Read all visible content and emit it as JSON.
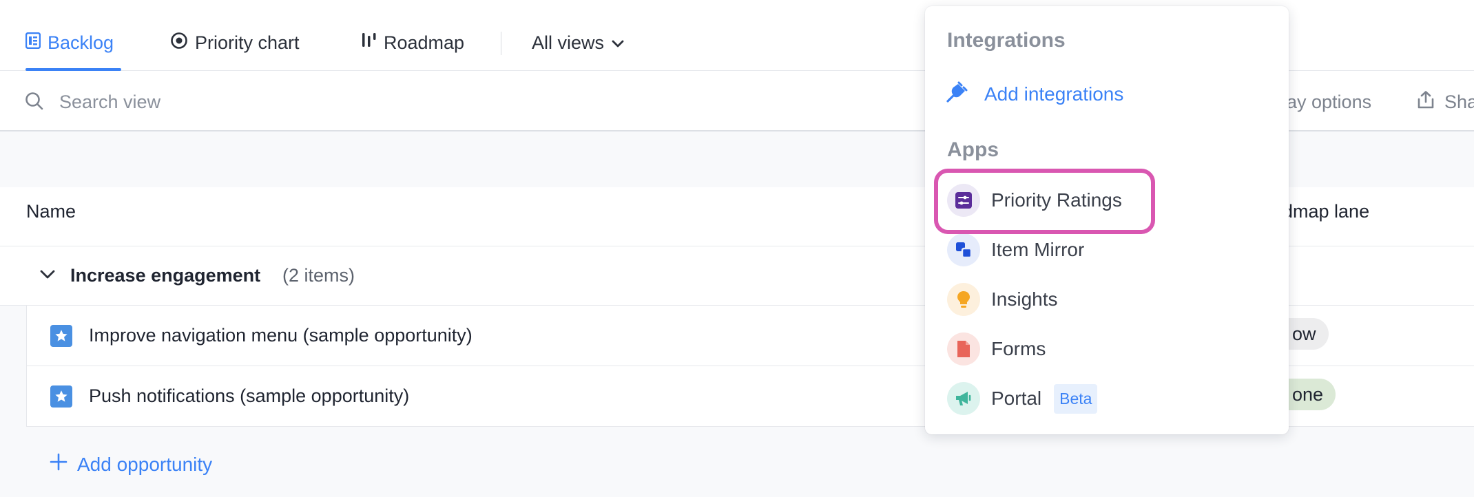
{
  "tabs": [
    {
      "label": "Backlog",
      "icon": "list-doc-icon",
      "active": true
    },
    {
      "label": "Priority chart",
      "icon": "target-icon",
      "active": false
    },
    {
      "label": "Roadmap",
      "icon": "roadmap-icon",
      "active": false
    }
  ],
  "all_views": {
    "label": "All views",
    "icon": "chevron-down-icon"
  },
  "search": {
    "placeholder": "Search view"
  },
  "toolbar": {
    "display_options": "lay options",
    "share": "Sha"
  },
  "table": {
    "columns": {
      "name": "Name",
      "roadmap_lane": "dmap lane"
    },
    "group": {
      "label": "Increase engagement",
      "count": "(2 items)"
    },
    "rows": [
      {
        "label": "Improve navigation menu (sample opportunity)",
        "lane": "ow"
      },
      {
        "label": "Push notifications (sample opportunity)",
        "lane": "one"
      }
    ],
    "add_label": "Add opportunity"
  },
  "dropdown": {
    "integrations_heading": "Integrations",
    "add_integrations": "Add integrations",
    "apps_heading": "Apps",
    "apps": [
      {
        "label": "Priority Ratings",
        "icon": "sliders-icon"
      },
      {
        "label": "Item Mirror",
        "icon": "mirror-icon"
      },
      {
        "label": "Insights",
        "icon": "lightbulb-icon"
      },
      {
        "label": "Forms",
        "icon": "form-doc-icon"
      },
      {
        "label": "Portal",
        "icon": "megaphone-icon",
        "badge": "Beta"
      }
    ]
  },
  "colors": {
    "accent": "#3b82f6",
    "highlight": "#d957b1",
    "lane_pill_1": "#ededee",
    "lane_pill_2": "#dbe9d6"
  }
}
